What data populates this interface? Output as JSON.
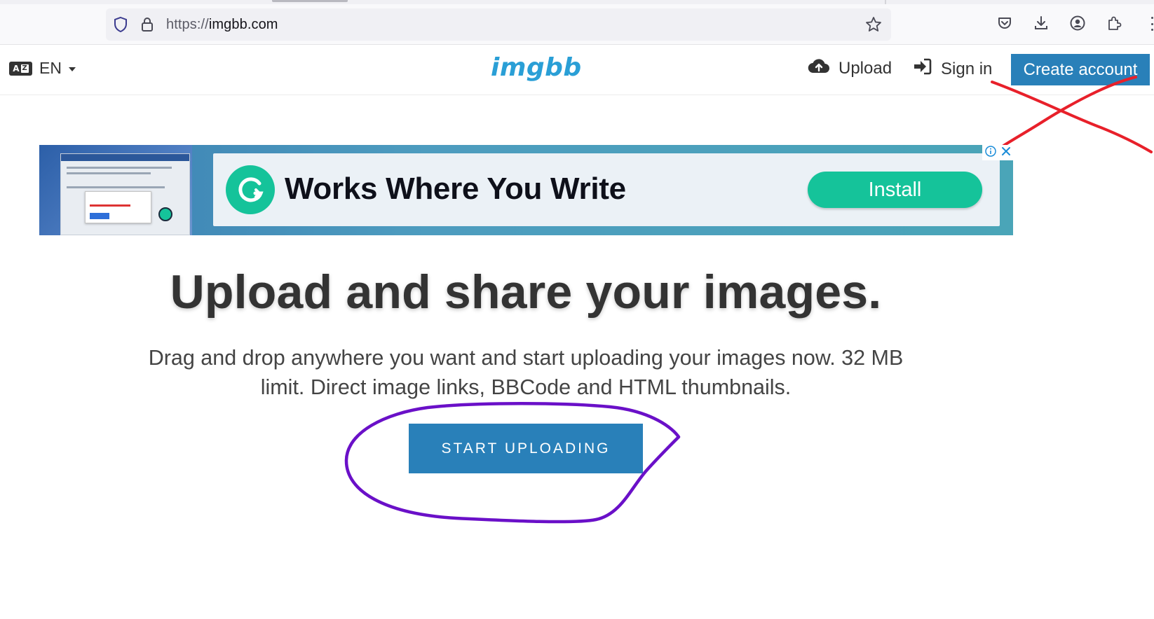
{
  "browser": {
    "url_scheme": "https://",
    "url_host": "imgbb.com",
    "icons": [
      "shield-icon",
      "lock-icon",
      "bookmark-star-icon",
      "pocket-icon",
      "download-icon",
      "account-icon",
      "extensions-icon",
      "overflow-menu-icon"
    ]
  },
  "header": {
    "language": "EN",
    "language_badge_left": "A",
    "language_badge_right": "Z",
    "logo": "imgbb",
    "upload_label": "Upload",
    "signin_label": "Sign in",
    "create_account_label": "Create account"
  },
  "ad": {
    "headline": "Works Where You Write",
    "install_label": "Install",
    "choices_icons": [
      "info-icon",
      "close-icon"
    ]
  },
  "hero": {
    "title": "Upload and share your images.",
    "subtitle_line1": "Drag and drop anywhere you want and start uploading your images now. 32 MB",
    "subtitle_line2": "limit. Direct image links, BBCode and HTML thumbnails.",
    "start_label": "START UPLOADING"
  },
  "annotations": {
    "red_cross_color": "#e8202a",
    "purple_circle_color": "#6a10c8"
  },
  "colors": {
    "brand_blue": "#2980b9",
    "logo_blue": "#2a9fd6",
    "ad_green": "#15c39a"
  }
}
